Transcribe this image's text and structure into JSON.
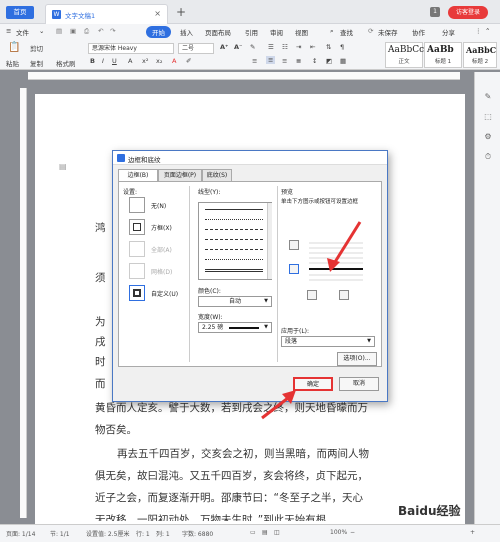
{
  "tabs": {
    "home": "首页",
    "doc": "文字文稿1",
    "badge": "1",
    "login": "访客登录"
  },
  "menu": {
    "file": "文件",
    "start": "开始",
    "insert": "插入",
    "layout": "页面布局",
    "ref": "引用",
    "review": "审阅",
    "view": "视图",
    "search": "查找",
    "sync": "未保存",
    "collab": "协作",
    "share": "分享"
  },
  "toolbar": {
    "paste": "粘贴",
    "cut": "剪切",
    "copy": "复制",
    "format": "格式刷",
    "font": "思源宋体 Heavy",
    "size": "二号"
  },
  "styles": [
    {
      "sample": "AaBbCc",
      "label": "正文"
    },
    {
      "sample": "AaBb",
      "label": "标题 1"
    },
    {
      "sample": "AaBbC",
      "label": "标题 2"
    }
  ],
  "document": {
    "lines": [
      "鸿",
      "须",
      "为",
      "戌",
      "时",
      "而",
      "黄昏而人定亥。譬于大数，若到戌会之终，则天地昏曚而万",
      "物否矣。",
      "再去五千四百岁，交亥会之初，则当黑暗，而两间人物",
      "俱无矣，故曰混沌。又五千四百岁，亥会将终，贞下起元，",
      "近子之会，而复逐渐开明。邵康节曰：“冬至子之半，天心",
      "无改移。一阳初动处，万物未生时。”到此天始有根。"
    ]
  },
  "dialog": {
    "title": "边框和底纹",
    "tabs": [
      "边框(B)",
      "页面边框(P)",
      "底纹(S)"
    ],
    "settings_label": "设置:",
    "settings": [
      "无(N)",
      "方框(X)",
      "全部(A)",
      "网格(D)",
      "自定义(U)"
    ],
    "linestyle_label": "线型(Y):",
    "color_label": "颜色(C):",
    "color_value": "自动",
    "width_label": "宽度(W):",
    "width_value": "2.25 磅",
    "preview_label": "预览",
    "preview_hint": "单击下方图示或按钮可设置边框",
    "apply_label": "应用于(L):",
    "apply_value": "段落",
    "options": "选项(O)...",
    "ok": "确定",
    "cancel": "取消"
  },
  "status": {
    "page": "页面: 1/14",
    "section": "节: 1/1",
    "setting": "设置值: 2.5厘米",
    "row": "行: 1",
    "col": "列: 1",
    "words": "字数: 6880",
    "zoom": "100%"
  },
  "watermark": "Baidu经验",
  "colors": {
    "accent": "#2f6fe0",
    "highlight": "#e53333"
  }
}
